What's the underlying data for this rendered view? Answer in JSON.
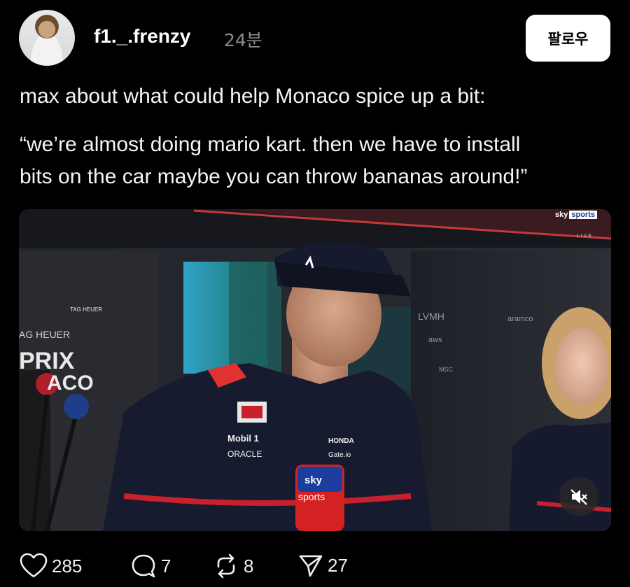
{
  "post": {
    "username": "f1._.frenzy",
    "time": "24분",
    "follow_label": "팔로우",
    "text_line1": "max about what could help Monaco spice up a bit:",
    "text_line2": "“we’re almost doing mario kart. then we have to install",
    "text_line3": "bits on the car maybe you can throw bananas around!”"
  },
  "video": {
    "broadcaster_logo_prefix": "sky",
    "broadcaster_logo_suffix": "sports",
    "broadcaster_live": "LIVE",
    "muted": true,
    "backdrop_text": [
      "TAG HEUER",
      "AG HEUER",
      "PRIX",
      "ACO",
      "LVMH",
      "aramco",
      "aws",
      "MSC"
    ],
    "shirt_text": [
      "Mobil 1",
      "ORACLE",
      "HONDA",
      "Gate.io"
    ],
    "mic_text": [
      "sky",
      "sports"
    ]
  },
  "actions": {
    "likes": "285",
    "comments": "7",
    "reposts": "8",
    "shares": "27"
  },
  "colors": {
    "background": "#000000",
    "text": "#f5f5f5",
    "muted_text": "#8c8c8c",
    "follow_bg": "#ffffff"
  }
}
